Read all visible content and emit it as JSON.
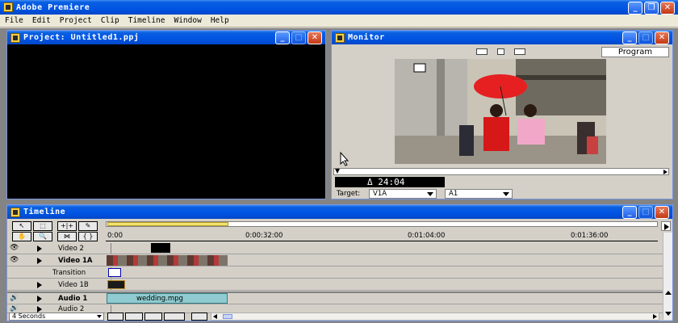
{
  "app": {
    "title": "Adobe Premiere",
    "colors": {
      "titlebar": "#0054e3",
      "close": "#c23a16",
      "panel": "#d4d0c8"
    }
  },
  "menu": [
    "File",
    "Edit",
    "Project",
    "Clip",
    "Timeline",
    "Window",
    "Help"
  ],
  "project": {
    "title": "Project: Untitled1.ppj"
  },
  "monitor": {
    "title": "Monitor",
    "program_label": "Program",
    "timecode": "Δ 24:04",
    "target_label": "Target:",
    "target_video": "V1A",
    "target_audio": "A1"
  },
  "timeline": {
    "title": "Timeline",
    "ruler": [
      "0:00",
      "0:00:32:00",
      "0:01:04:00",
      "0:01:36:00"
    ],
    "tracks": [
      {
        "name": "Video 2",
        "bold": false
      },
      {
        "name": "Video 1A",
        "bold": true
      },
      {
        "name": "Transition",
        "bold": false
      },
      {
        "name": "Video 1B",
        "bold": false
      },
      {
        "name": "Audio 1",
        "bold": true
      },
      {
        "name": "Audio 2",
        "bold": false
      }
    ],
    "audio_clip": "wedding.mpg",
    "zoom": "4 Seconds"
  },
  "icons": {
    "close": "✕",
    "minimize": "_",
    "maximize": "□",
    "restore": "❐",
    "eye": "👁",
    "speaker": "🔊"
  }
}
